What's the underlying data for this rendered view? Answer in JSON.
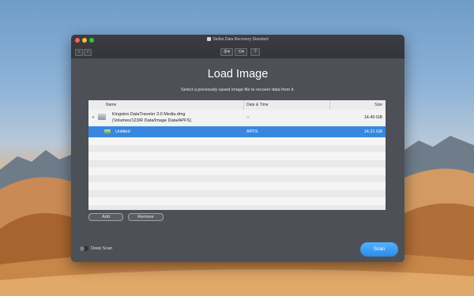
{
  "app": {
    "title": "Stellar Data Recovery Standard"
  },
  "toolbar": {
    "back_glyph": "‹",
    "forward_glyph": "›",
    "settings_glyph": "⚙▾",
    "history_glyph": "⟲▾",
    "help_glyph": "?"
  },
  "dialog": {
    "heading": "Load Image",
    "subheading": "Select a previously saved image file to recover data from it."
  },
  "table": {
    "columns": {
      "name": "Name",
      "date": "Date & Time",
      "size": "Size"
    },
    "parent": {
      "name_line1": "Kingston DataTraveler 3.0 Media.dmg",
      "name_line2": "(Volumes/123/R Data/Image Data/APFS)",
      "date": "--",
      "size": "14.40 GB",
      "expanded": true
    },
    "selected": {
      "name": "Untitled",
      "date": "APFS",
      "size": "14.21 GB"
    }
  },
  "buttons": {
    "add": "Add",
    "remove": "Remove",
    "scan": "Scan"
  },
  "options": {
    "deep_scan_label": "Deep Scan",
    "deep_scan_on": false
  },
  "colors": {
    "accent": "#3787e0",
    "window_bg": "#4d5056",
    "scan_button": "#3a9af0"
  },
  "icons": [
    "back-icon",
    "forward-icon",
    "settings-icon",
    "history-icon",
    "help-icon",
    "disk-image-icon",
    "volume-icon",
    "disclosure-triangle-icon"
  ]
}
